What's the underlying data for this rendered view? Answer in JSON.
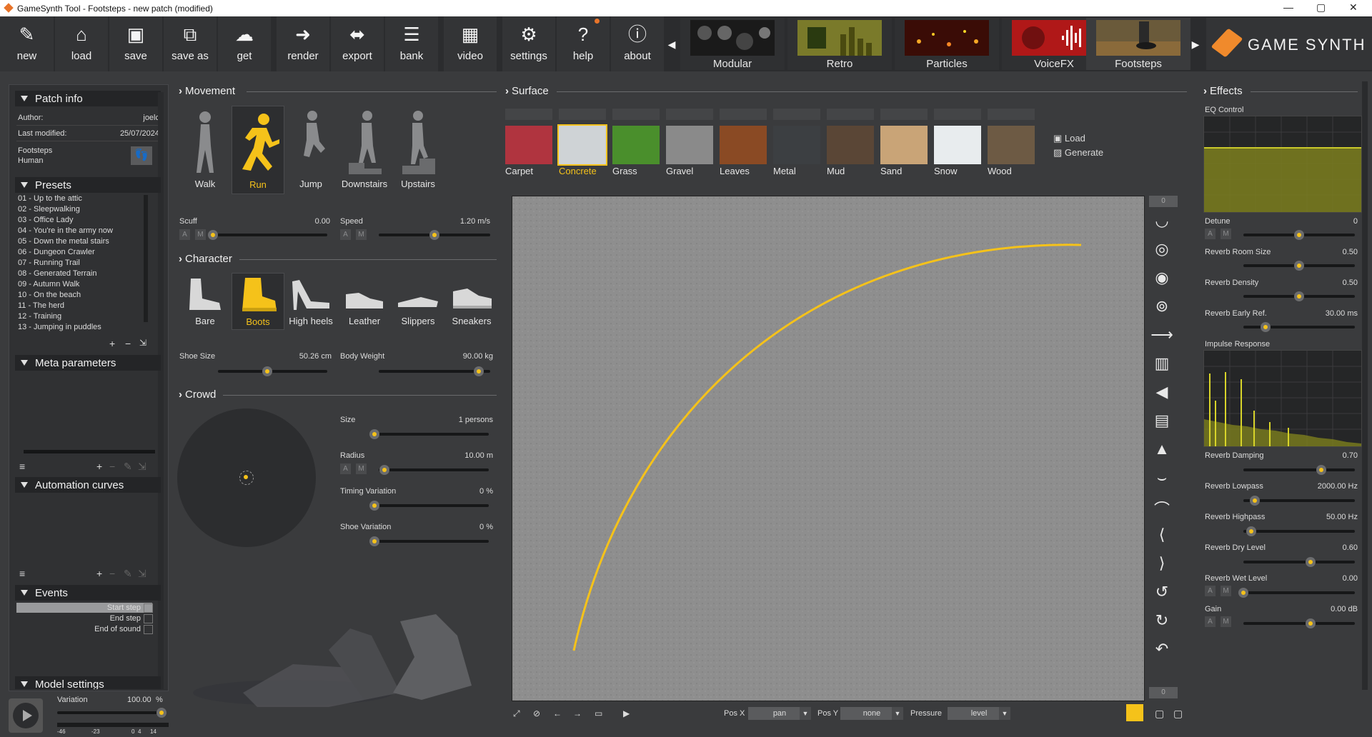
{
  "window": {
    "title": "GameSynth Tool - Footsteps - new patch (modified)",
    "minimize": "—",
    "maximize": "▢",
    "close": "✕"
  },
  "toolbar": {
    "buttons": [
      {
        "label": "new",
        "icon": "new-icon"
      },
      {
        "label": "load",
        "icon": "load-icon"
      },
      {
        "label": "save",
        "icon": "save-icon"
      },
      {
        "label": "save as",
        "icon": "save-as-icon"
      },
      {
        "label": "get",
        "icon": "get-icon"
      },
      {
        "label": "render",
        "icon": "render-icon"
      },
      {
        "label": "export",
        "icon": "export-icon"
      },
      {
        "label": "bank",
        "icon": "bank-icon"
      },
      {
        "label": "video",
        "icon": "video-icon"
      },
      {
        "label": "settings",
        "icon": "gear-icon"
      },
      {
        "label": "help",
        "icon": "help-icon"
      },
      {
        "label": "about",
        "icon": "info-icon"
      }
    ],
    "models": [
      "Modular",
      "Retro",
      "Particles",
      "VoiceFX",
      "Footsteps"
    ],
    "logo": "GAME SYNTH"
  },
  "patch_info": {
    "title": "Patch info",
    "author_label": "Author:",
    "author": "joelc",
    "modified_label": "Last modified:",
    "modified": "25/07/2024",
    "category1": "Footsteps",
    "category2": "Human"
  },
  "presets": {
    "title": "Presets",
    "items": [
      "01 - Up to the attic",
      "02 - Sleepwalking",
      "03 - Office Lady",
      "04 - You're in the army now",
      "05 - Down the metal stairs",
      "06 - Dungeon Crawler",
      "07 - Running Trail",
      "08 - Generated Terrain",
      "09 - Autumn Walk",
      "10 - On the beach",
      "11 - The herd",
      "12 - Training",
      "13 - Jumping in puddles"
    ]
  },
  "meta_parameters": {
    "title": "Meta parameters"
  },
  "automation_curves": {
    "title": "Automation curves"
  },
  "events": {
    "title": "Events",
    "items": [
      "Start step",
      "End step",
      "End of sound"
    ]
  },
  "model_settings": {
    "title": "Model settings"
  },
  "player": {
    "variation_label": "Variation",
    "variation_value": "100.00",
    "variation_unit": "%",
    "variation_level": 1.0,
    "meter_scale": [
      "-46",
      "-23",
      "0",
      "4",
      "14"
    ]
  },
  "movement": {
    "title": "Movement",
    "items": [
      "Walk",
      "Run",
      "Jump",
      "Downstairs",
      "Upstairs"
    ],
    "selected": "Run",
    "scuff_label": "Scuff",
    "scuff_value": "0.00",
    "scuff_level": 0.0,
    "speed_label": "Speed",
    "speed_value": "1.20 m/s",
    "speed_level": 0.5
  },
  "character": {
    "title": "Character",
    "items": [
      "Bare",
      "Boots",
      "High heels",
      "Leather",
      "Slippers",
      "Sneakers"
    ],
    "selected": "Boots",
    "shoe_label": "Shoe Size",
    "shoe_value": "50.26 cm",
    "shoe_level": 0.45,
    "weight_label": "Body Weight",
    "weight_value": "90.00 kg",
    "weight_level": 0.9
  },
  "crowd": {
    "title": "Crowd",
    "size_label": "Size",
    "size_value": "1 persons",
    "size_level": 0.0,
    "radius_label": "Radius",
    "radius_value": "10.00 m",
    "radius_level": 0.05,
    "timing_label": "Timing Variation",
    "timing_value": "0 %",
    "timing_level": 0.0,
    "shoevar_label": "Shoe Variation",
    "shoevar_value": "0 %",
    "shoevar_level": 0.0
  },
  "surface": {
    "title": "Surface",
    "items": [
      "Carpet",
      "Concrete",
      "Grass",
      "Gravel",
      "Leaves",
      "Metal",
      "Mud",
      "Sand",
      "Snow",
      "Wood"
    ],
    "selected": "Concrete",
    "load_label": "Load",
    "generate_label": "Generate",
    "colors": [
      "#b0343f",
      "#cfd3d6",
      "#4a8f2c",
      "#8a8a8a",
      "#8a4a24",
      "#3c3f42",
      "#5a4636",
      "#c9a477",
      "#e8ecee",
      "#6d5a44"
    ]
  },
  "effects": {
    "title": "Effects",
    "eq_label": "EQ Control",
    "detune_label": "Detune",
    "detune_value": "0",
    "detune_level": 0.5,
    "room_label": "Reverb Room Size",
    "room_value": "0.50",
    "room_level": 0.5,
    "density_label": "Reverb Density",
    "density_value": "0.50",
    "density_level": 0.5,
    "early_label": "Reverb Early Ref.",
    "early_value": "30.00 ms",
    "early_level": 0.2,
    "impulse_label": "Impulse Response",
    "damping_label": "Reverb Damping",
    "damping_value": "0.70",
    "damping_level": 0.7,
    "lowpass_label": "Reverb Lowpass",
    "lowpass_value": "2000.00 Hz",
    "lowpass_level": 0.1,
    "highpass_label": "Reverb Highpass",
    "highpass_value": "50.00 Hz",
    "highpass_level": 0.07,
    "dry_label": "Reverb Dry Level",
    "dry_value": "0.60",
    "dry_level": 0.6,
    "wet_label": "Reverb Wet Level",
    "wet_value": "0.00",
    "wet_level": 0.0,
    "gain_label": "Gain",
    "gain_value": "0.00 dB",
    "gain_level": 0.6
  },
  "bottom": {
    "posx_label": "Pos X",
    "posx_value": "pan",
    "posy_label": "Pos Y",
    "posy_value": "none",
    "pressure_label": "Pressure",
    "pressure_value": "level",
    "counter_top": "0",
    "counter_bottom": "0"
  },
  "colors": {
    "accent": "#f5c21a",
    "bg": "#3a3b3d",
    "logo": "#f08a2c"
  }
}
